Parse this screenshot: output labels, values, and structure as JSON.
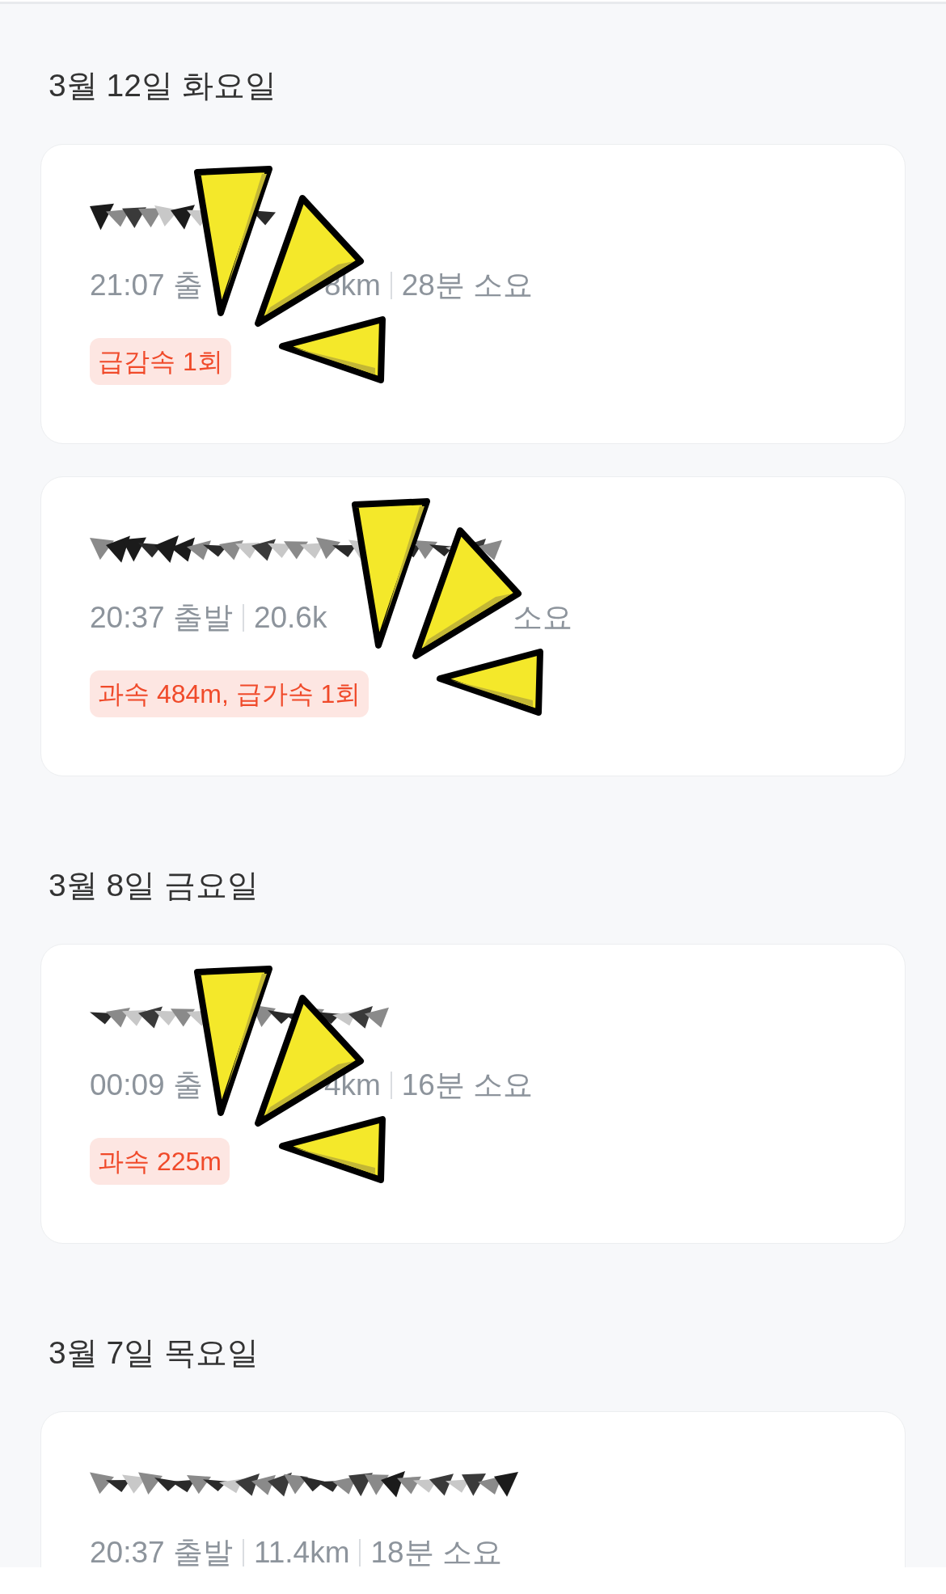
{
  "days": [
    {
      "date": "3월 12일 화요일",
      "trips": [
        {
          "meta": [
            {
              "kind": "text",
              "text": "21:07 출"
            },
            {
              "kind": "covered"
            },
            {
              "kind": "text",
              "text": "8km"
            },
            {
              "kind": "divider"
            },
            {
              "kind": "text",
              "text": "28분 소요"
            }
          ],
          "badge": "급감속 1회",
          "sticker": true
        },
        {
          "meta": [
            {
              "kind": "text",
              "text": "20:37 출발"
            },
            {
              "kind": "divider"
            },
            {
              "kind": "text",
              "text": "20.6k"
            },
            {
              "kind": "covered"
            },
            {
              "kind": "text",
              "text": "소요"
            }
          ],
          "badge": "과속 484m, 급가속 1회",
          "sticker": true
        }
      ]
    },
    {
      "date": "3월 8일 금요일",
      "trips": [
        {
          "meta": [
            {
              "kind": "text",
              "text": "00:09 출"
            },
            {
              "kind": "covered"
            },
            {
              "kind": "text",
              "text": "4km"
            },
            {
              "kind": "divider"
            },
            {
              "kind": "text",
              "text": "16분 소요"
            }
          ],
          "badge": "과속 225m",
          "sticker": true
        }
      ]
    },
    {
      "date": "3월 7일 목요일",
      "trips": [
        {
          "meta": [
            {
              "kind": "text",
              "text": "20:37 출발"
            },
            {
              "kind": "divider"
            },
            {
              "kind": "text",
              "text": "11.4km"
            },
            {
              "kind": "divider"
            },
            {
              "kind": "text",
              "text": "18분 소요"
            }
          ],
          "sticker": false
        }
      ]
    }
  ]
}
